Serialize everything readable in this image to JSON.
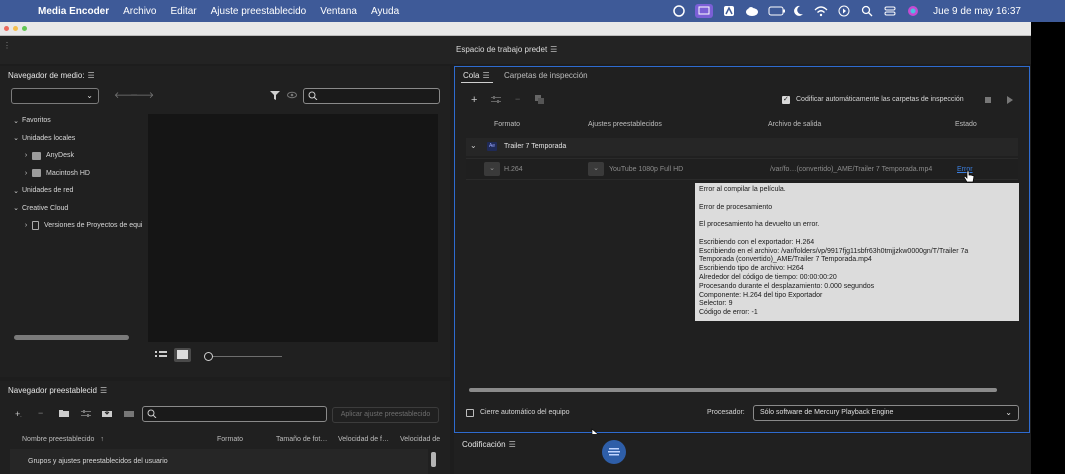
{
  "menubar": {
    "app_name": "Media Encoder",
    "menus": [
      "Archivo",
      "Editar",
      "Ajuste preestablecido",
      "Ventana",
      "Ayuda"
    ],
    "clock": "Jue 9 de may  16:37"
  },
  "workspace": {
    "label": "Espacio de trabajo predet"
  },
  "media_browser": {
    "title": "Navegador de medio:",
    "tree": [
      {
        "label": "Favoritos",
        "expanded": true,
        "indent": 0
      },
      {
        "label": "Unidades locales",
        "expanded": true,
        "indent": 0
      },
      {
        "label": "AnyDesk",
        "expanded": false,
        "indent": 1
      },
      {
        "label": "Macintosh HD",
        "expanded": false,
        "indent": 1
      },
      {
        "label": "Unidades de red",
        "expanded": true,
        "indent": 0
      },
      {
        "label": "Creative Cloud",
        "expanded": true,
        "indent": 0
      },
      {
        "label": "Versiones de Proyectos de equi",
        "expanded": false,
        "indent": 1
      }
    ]
  },
  "preset_browser": {
    "title": "Navegador preestablecid",
    "apply_button": "Aplicar ajuste preestablecido",
    "columns": [
      "Nombre preestablecido",
      "Formato",
      "Tamaño de fot…",
      "Velocidad de f…",
      "Velocidad de"
    ],
    "sort_arrow": "↑",
    "group_row": "Grupos y ajustes preestablecidos del usuario"
  },
  "queue": {
    "tabs": [
      "Cola",
      "Carpetas de inspección"
    ],
    "auto_encode_label": "Codificar automáticamente las carpetas de inspección",
    "columns": [
      "Formato",
      "Ajustes preestablecidos",
      "Archivo de salida",
      "Estado"
    ],
    "group": {
      "badge": "Ae",
      "name": "Trailer 7 Temporada"
    },
    "item": {
      "format": "H.264",
      "preset": "YouTube 1080p Full HD",
      "output": "/var/fo…(convertido)_AME/Trailer 7 Temporada.mp4",
      "status": "Error"
    },
    "tooltip_lines": [
      "Error al compilar la película.",
      "",
      "Error de procesamiento",
      "",
      "El procesamiento ha devuelto un error.",
      "",
      "Escribiendo con el exportador: H.264",
      "Escribiendo en el archivo: /var/folders/vp/9917fjg11sbfr63h0tmjjzkw0000gn/T/Trailer 7a",
      "Temporada (convertido)_AME/Trailer 7 Temporada.mp4",
      "Escribiendo tipo de archivo: H264",
      "Alrededor del código de tiempo: 00:00:00:20",
      "Procesando durante el desplazamiento: 0.000 segundos",
      "Componente: H.264 del tipo Exportador",
      "Selector: 9",
      "Código de error: -1"
    ],
    "auto_shutdown_label": "Cierre automático del equipo",
    "processor_label": "Procesador:",
    "processor_value": "Sólo software de Mercury Playback Engine"
  },
  "encoding": {
    "title": "Codificación"
  }
}
